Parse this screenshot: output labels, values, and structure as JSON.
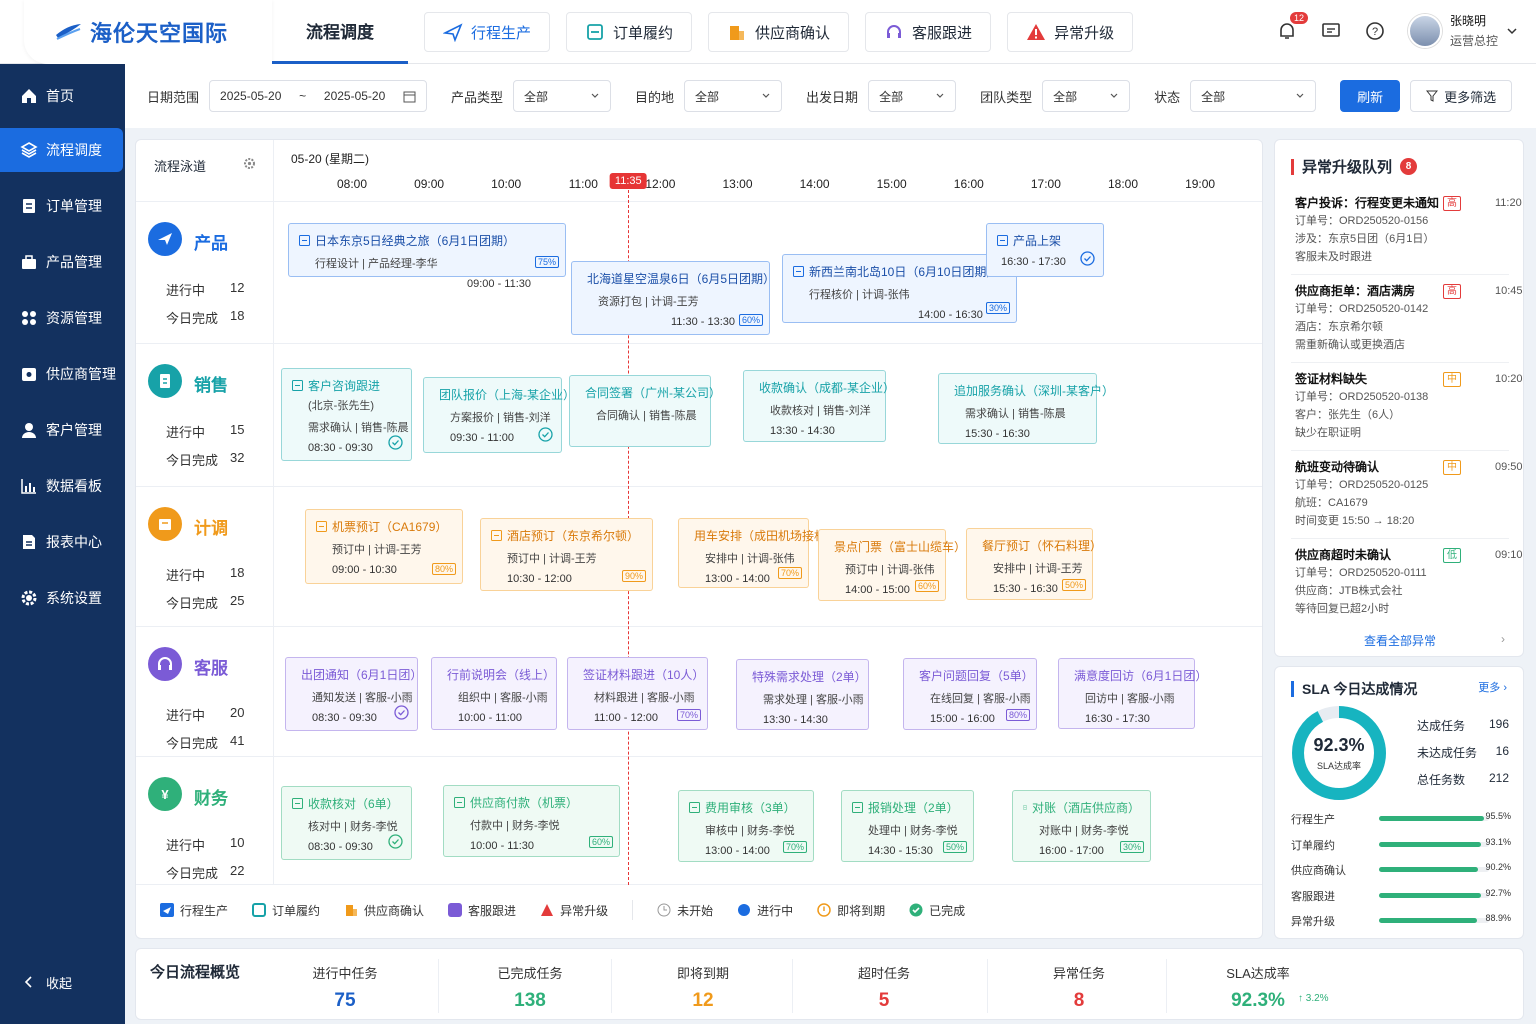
{
  "app": {
    "name": "海伦天空国际"
  },
  "nav": {
    "tabs": [
      {
        "label": "流程调度"
      },
      {
        "label": "行程生产"
      },
      {
        "label": "订单履约"
      },
      {
        "label": "供应商确认"
      },
      {
        "label": "客服跟进"
      },
      {
        "label": "异常升级"
      }
    ]
  },
  "header": {
    "notification_count": "12",
    "user_name": "张晓明",
    "user_role": "运营总控"
  },
  "sidebar": {
    "items": [
      {
        "label": "首页"
      },
      {
        "label": "流程调度"
      },
      {
        "label": "订单管理"
      },
      {
        "label": "产品管理"
      },
      {
        "label": "资源管理"
      },
      {
        "label": "供应商管理"
      },
      {
        "label": "客户管理"
      },
      {
        "label": "数据看板"
      },
      {
        "label": "报表中心"
      },
      {
        "label": "系统设置"
      }
    ],
    "collapse": "收起"
  },
  "filters": {
    "date_label": "日期范围",
    "date_start": "2025-05-20",
    "date_sep": "~",
    "date_end": "2025-05-20",
    "product_label": "产品类型",
    "product": "全部",
    "dest_label": "目的地",
    "dest": "全部",
    "depart_label": "出发日期",
    "depart": "全部",
    "group_label": "团队类型",
    "group": "全部",
    "status_label": "状态",
    "status": "全部",
    "refresh": "刷新",
    "more": "更多筛选"
  },
  "board": {
    "lane_header": "流程泳道",
    "date": "05-20 (星期二)",
    "times": [
      "08:00",
      "09:00",
      "10:00",
      "11:00",
      "12:00",
      "13:00",
      "14:00",
      "15:00",
      "16:00",
      "17:00",
      "18:00",
      "19:00"
    ],
    "now": "11:35",
    "stat_running": "进行中",
    "stat_done": "今日完成",
    "lanes": [
      {
        "title": "产品",
        "running": "12",
        "done": "18"
      },
      {
        "title": "销售",
        "running": "15",
        "done": "32"
      },
      {
        "title": "计调",
        "running": "18",
        "done": "25"
      },
      {
        "title": "客服",
        "running": "20",
        "done": "41"
      },
      {
        "title": "财务",
        "running": "10",
        "done": "22"
      }
    ],
    "cards": [
      {
        "lane": 0,
        "title": "日本东京5日经典之旅（6月1日团期）",
        "sub": "行程设计 | 产品经理-李华",
        "time": "09:00 - 11:30",
        "pct": "75%"
      },
      {
        "lane": 0,
        "title": "北海道星空温泉6日（6月5日团期）",
        "sub": "资源打包 | 计调-王芳",
        "time": "11:30 - 13:30",
        "pct": "60%"
      },
      {
        "lane": 0,
        "title": "新西兰南北岛10日（6月10日团期）",
        "sub": "行程核价 | 计调-张伟",
        "time": "14:00 - 16:30",
        "pct": "30%"
      },
      {
        "lane": 0,
        "title": "产品上架",
        "sub": "",
        "time": "16:30 - 17:30",
        "pct": ""
      },
      {
        "lane": 1,
        "title": "客户咨询跟进",
        "title2": "(北京-张先生)",
        "sub": "需求确认 | 销售-陈晨",
        "time": "08:30 - 09:30",
        "pct": ""
      },
      {
        "lane": 1,
        "title": "团队报价（上海-某企业）",
        "sub": "方案报价 | 销售-刘洋",
        "time": "09:30 - 11:00",
        "pct": ""
      },
      {
        "lane": 1,
        "title": "合同签署（广州-某公司）",
        "sub": "合同确认 | 销售-陈晨",
        "time": "",
        "pct": ""
      },
      {
        "lane": 1,
        "title": "收款确认（成都-某企业）",
        "sub": "收款核对 | 销售-刘洋",
        "time": "13:30 - 14:30",
        "pct": ""
      },
      {
        "lane": 1,
        "title": "追加服务确认（深圳-某客户）",
        "sub": "需求确认 | 销售-陈晨",
        "time": "15:30 - 16:30",
        "pct": ""
      },
      {
        "lane": 2,
        "title": "机票预订（CA1679）",
        "sub": "预订中 | 计调-王芳",
        "time": "09:00 - 10:30",
        "pct": "80%"
      },
      {
        "lane": 2,
        "title": "酒店预订（东京希尔顿）",
        "sub": "预订中 | 计调-王芳",
        "time": "10:30 - 12:00",
        "pct": "90%"
      },
      {
        "lane": 2,
        "title": "用车安排（成田机场接机）",
        "sub": "安排中 | 计调-张伟",
        "time": "13:00 - 14:00",
        "pct": "70%"
      },
      {
        "lane": 2,
        "title": "景点门票（富士山缆车）",
        "sub": "预订中 | 计调-张伟",
        "time": "14:00 - 15:00",
        "pct": "60%"
      },
      {
        "lane": 2,
        "title": "餐厅预订（怀石料理）",
        "sub": "安排中 | 计调-王芳",
        "time": "15:30 - 16:30",
        "pct": "50%"
      },
      {
        "lane": 3,
        "title": "出团通知（6月1日团）",
        "sub": "通知发送 | 客服-小雨",
        "time": "08:30 - 09:30",
        "pct": ""
      },
      {
        "lane": 3,
        "title": "行前说明会（线上）",
        "sub": "组织中 | 客服-小雨",
        "time": "10:00 - 11:00",
        "pct": ""
      },
      {
        "lane": 3,
        "title": "签证材料跟进（10人）",
        "sub": "材料跟进 | 客服-小雨",
        "time": "11:00 - 12:00",
        "pct": "70%"
      },
      {
        "lane": 3,
        "title": "特殊需求处理（2单）",
        "sub": "需求处理 | 客服-小雨",
        "time": "13:30 - 14:30",
        "pct": ""
      },
      {
        "lane": 3,
        "title": "客户问题回复（5单）",
        "sub": "在线回复 | 客服-小雨",
        "time": "15:00 - 16:00",
        "pct": "80%"
      },
      {
        "lane": 3,
        "title": "满意度回访（6月1日团）",
        "sub": "回访中 | 客服-小雨",
        "time": "16:30 - 17:30",
        "pct": ""
      },
      {
        "lane": 4,
        "title": "收款核对（6单）",
        "sub": "核对中 | 财务-李悦",
        "time": "08:30 - 09:30",
        "pct": ""
      },
      {
        "lane": 4,
        "title": "供应商付款（机票）",
        "sub": "付款中 | 财务-李悦",
        "time": "10:00 - 11:30",
        "pct": "60%"
      },
      {
        "lane": 4,
        "title": "费用审核（3单）",
        "sub": "审核中 | 财务-李悦",
        "time": "13:00 - 14:00",
        "pct": "70%"
      },
      {
        "lane": 4,
        "title": "报销处理（2单）",
        "sub": "处理中 | 财务-李悦",
        "time": "14:30 - 15:30",
        "pct": "50%"
      },
      {
        "lane": 4,
        "title": "对账（酒店供应商）",
        "sub": "对账中 | 财务-李悦",
        "time": "16:00 - 17:00",
        "pct": "30%"
      }
    ],
    "legend": [
      "行程生产",
      "订单履约",
      "供应商确认",
      "客服跟进",
      "异常升级",
      "未开始",
      "进行中",
      "即将到期",
      "已完成"
    ]
  },
  "escalation": {
    "title": "异常升级队列",
    "count": "8",
    "view_all": "查看全部异常",
    "items": [
      {
        "title": "客户投诉：行程变更未通知",
        "sev": "高",
        "time": "11:20",
        "l1": "订单号：ORD250520-0156",
        "l2": "涉及：东京5日团（6月1日）",
        "l3": "客服未及时跟进"
      },
      {
        "title": "供应商拒单：酒店满房",
        "sev": "高",
        "time": "10:45",
        "l1": "订单号：ORD250520-0142",
        "l2": "酒店：东京希尔顿",
        "l3": "需重新确认或更换酒店"
      },
      {
        "title": "签证材料缺失",
        "sev": "中",
        "time": "10:20",
        "l1": "订单号：ORD250520-0138",
        "l2": "客户：张先生（6人）",
        "l3": "缺少在职证明"
      },
      {
        "title": "航班变动待确认",
        "sev": "中",
        "time": "09:50",
        "l1": "订单号：ORD250520-0125",
        "l2": "航班：CA1679",
        "l3": "时间变更 15:50 → 18:20"
      },
      {
        "title": "供应商超时未确认",
        "sev": "低",
        "time": "09:10",
        "l1": "订单号：ORD250520-0111",
        "l2": "供应商：JTB株式会社",
        "l3": "等待回复已超2小时"
      }
    ]
  },
  "sla": {
    "title": "SLA 今日达成情况",
    "more": "更多",
    "rate": "92.3%",
    "rate_label": "SLA达成率",
    "rate_value": 0.923,
    "met_label": "达成任务",
    "met": "196",
    "unmet_label": "未达成任务",
    "unmet": "16",
    "total_label": "总任务数",
    "total": "212",
    "rows": [
      {
        "label": "行程生产",
        "val": "95.5%",
        "v": 0.955
      },
      {
        "label": "订单履约",
        "val": "93.1%",
        "v": 0.931
      },
      {
        "label": "供应商确认",
        "val": "90.2%",
        "v": 0.902
      },
      {
        "label": "客服跟进",
        "val": "92.7%",
        "v": 0.927
      },
      {
        "label": "异常升级",
        "val": "88.9%",
        "v": 0.889
      }
    ]
  },
  "summary": {
    "title": "今日流程概览",
    "items": [
      {
        "label": "进行中任务",
        "value": "75"
      },
      {
        "label": "已完成任务",
        "value": "138"
      },
      {
        "label": "即将到期",
        "value": "12"
      },
      {
        "label": "超时任务",
        "value": "5"
      },
      {
        "label": "异常任务",
        "value": "8"
      },
      {
        "label": "SLA达成率",
        "value": "92.3%"
      }
    ],
    "trend": "↑ 3.2%"
  },
  "colors": {
    "primary": "#1b6ce0",
    "sidebar": "#13315f",
    "product": "#1b6ce0",
    "sales": "#17a2a8",
    "ops": "#f09a1b",
    "service": "#7b5bd6",
    "finance": "#2fb07a",
    "danger": "#e33b3b"
  }
}
